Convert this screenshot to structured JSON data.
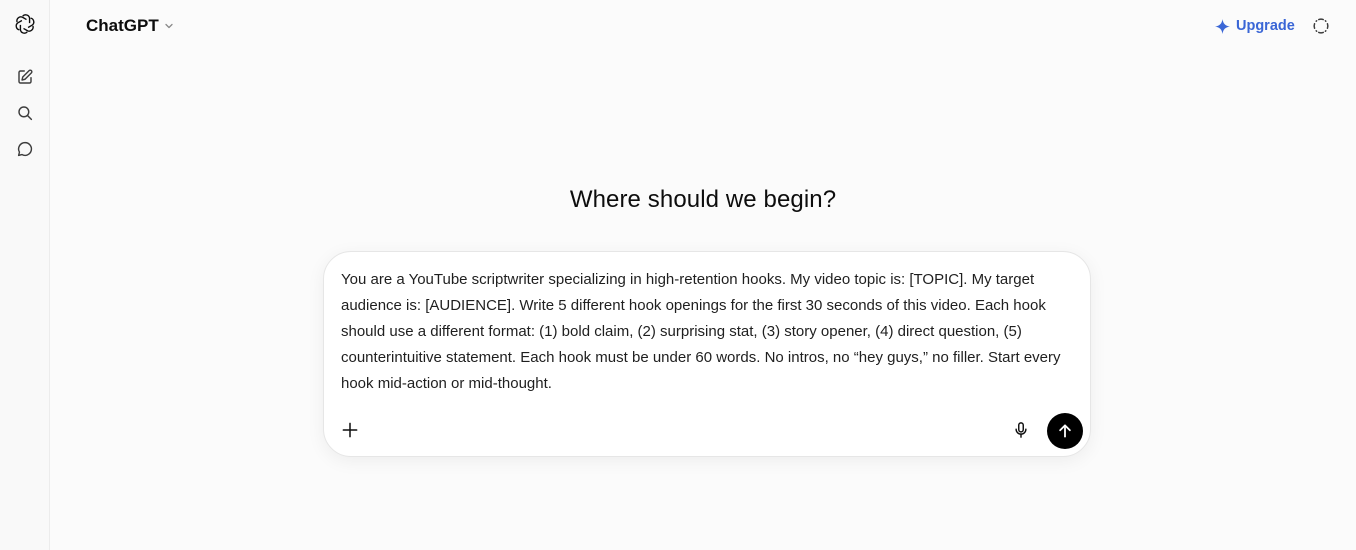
{
  "header": {
    "model_label": "ChatGPT",
    "upgrade_label": "Upgrade"
  },
  "sidebar": {
    "items": [
      {
        "icon": "new-chat-icon"
      },
      {
        "icon": "search-icon"
      },
      {
        "icon": "chat-bubble-icon"
      }
    ]
  },
  "main": {
    "heading": "Where should we begin?"
  },
  "composer": {
    "prompt_text": "You are a YouTube scriptwriter specializing in high-retention hooks. My video topic is: [TOPIC]. My target audience is: [AUDIENCE]. Write 5 different hook openings for the first 30 seconds of this video. Each hook should use a different format: (1) bold claim, (2) surprising stat, (3) story opener, (4) direct question, (5) counterintuitive statement. Each hook must be under 60 words. No intros, no “hey guys,” no filler. Start every hook mid-action or mid-thought."
  },
  "colors": {
    "accent": "#3a66d6",
    "send_button": "#000000",
    "background": "#fbfbfb"
  }
}
